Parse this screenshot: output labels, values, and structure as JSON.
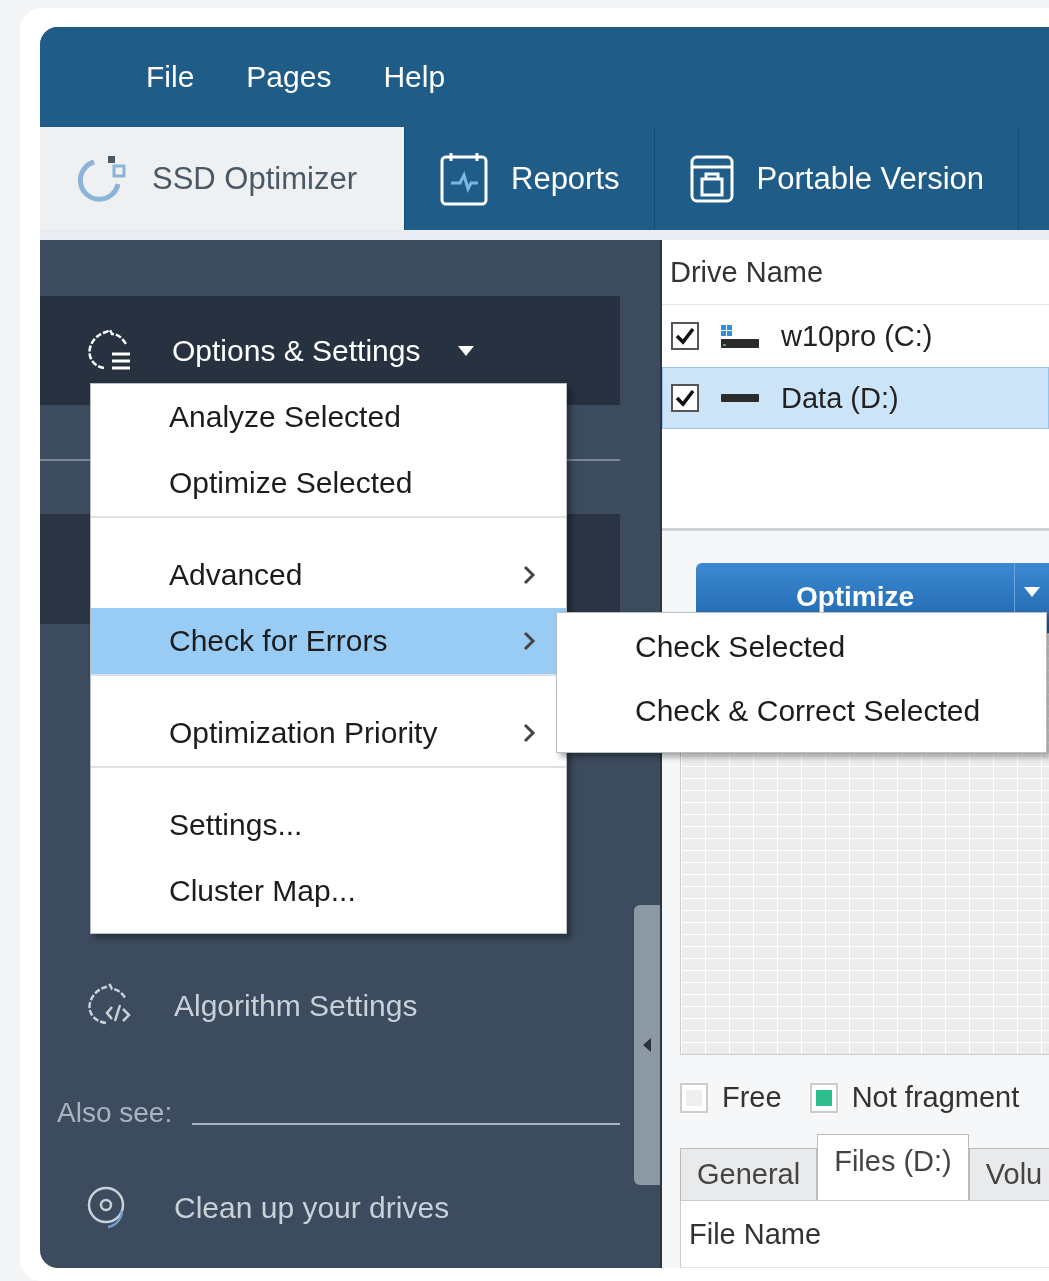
{
  "menu_bar": [
    {
      "label": "File"
    },
    {
      "label": "Pages"
    },
    {
      "label": "Help"
    }
  ],
  "tabs": [
    {
      "label": "SSD Optimizer",
      "kind": "optimizer",
      "selected": true
    },
    {
      "label": "Reports",
      "kind": "reports",
      "selected": false
    },
    {
      "label": "Portable Version",
      "kind": "portable",
      "selected": false
    }
  ],
  "sidebar": {
    "header": {
      "label": "Options & Settings",
      "expanded": true
    },
    "items": [
      {
        "label": "Algorithm Settings",
        "kind": "algorithm"
      }
    ],
    "also_see": "Also see:",
    "links": [
      {
        "label": "Clean up your drives",
        "kind": "disc"
      }
    ]
  },
  "context_menu": {
    "groups": [
      {
        "items": [
          {
            "label": "Analyze Selected",
            "has_submenu": false,
            "selected": false
          },
          {
            "label": "Optimize Selected",
            "has_submenu": false,
            "selected": false
          }
        ]
      },
      {
        "items": [
          {
            "label": "Advanced",
            "has_submenu": true,
            "selected": false
          },
          {
            "label": "Check for Errors",
            "has_submenu": true,
            "selected": true
          }
        ]
      },
      {
        "items": [
          {
            "label": "Optimization Priority",
            "has_submenu": true,
            "selected": false
          }
        ]
      },
      {
        "items": [
          {
            "label": "Settings...",
            "has_submenu": false,
            "selected": false
          },
          {
            "label": "Cluster Map...",
            "has_submenu": false,
            "selected": false
          }
        ]
      }
    ]
  },
  "submenu": {
    "items": [
      {
        "label": "Check Selected"
      },
      {
        "label": "Check & Correct Selected"
      }
    ]
  },
  "drives": {
    "column": "Drive Name",
    "rows": [
      {
        "name": "w10pro (C:)",
        "kind": "system",
        "checked": true,
        "selected": false
      },
      {
        "name": "Data (D:)",
        "kind": "data",
        "checked": true,
        "selected": true
      }
    ]
  },
  "optimize_button": {
    "label": "Optimize"
  },
  "legend": [
    {
      "label": "Free",
      "color": "#eeeeee"
    },
    {
      "label": "Not fragment",
      "color": "#2ebd8c"
    }
  ],
  "bottom_tabs": [
    {
      "label": "General",
      "selected": false
    },
    {
      "label": "Files (D:)",
      "selected": true
    },
    {
      "label": "Volu",
      "selected": false
    }
  ],
  "file_table": {
    "column": "File Name"
  }
}
